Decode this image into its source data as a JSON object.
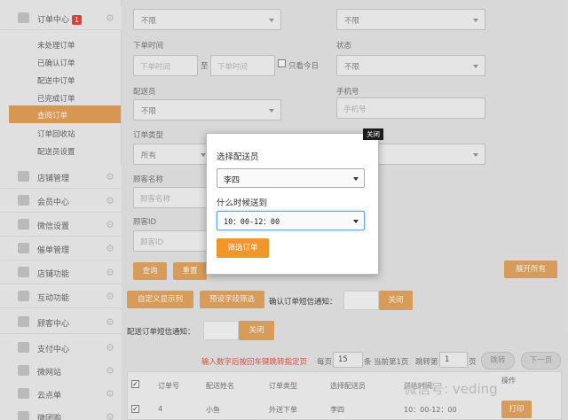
{
  "sidebar": {
    "order_center": "订单中心",
    "order_badge": "1",
    "subitems": [
      "未处理订单",
      "已确认订单",
      "配送中订单",
      "已完成订单",
      "查阅订单",
      "订单回收站",
      "配送员设置"
    ],
    "menus": [
      "店铺管理",
      "会员中心",
      "微信设置",
      "催单管理",
      "店铺功能",
      "互动功能",
      "顾客中心",
      "支付中心",
      "微网站",
      "云点单",
      "微团购"
    ]
  },
  "form": {
    "top_left_select": "不限",
    "top_right_select": "不限",
    "order_time_label": "下单时间",
    "time_from_placeholder": "下单时间",
    "to": "至",
    "time_to_placeholder": "下单时间",
    "today_only": "只看今日",
    "status_label": "状态",
    "status_value": "不限",
    "deliverer_label": "配送员",
    "deliverer_value": "不限",
    "phone_label": "手机号",
    "phone_placeholder": "手机号",
    "order_type_label": "订单类型",
    "order_type_value": "所有",
    "customer_name_label": "顾客名称",
    "customer_name_placeholder": "顾客名称",
    "customer_id_label": "顾客ID",
    "customer_id_placeholder": "顾客ID",
    "query_btn": "查询",
    "reset_btn": "重置",
    "expand_all": "展开所有",
    "custom_display": "自定义显示列",
    "preset_filter": "预设字段筛选",
    "confirm_sms_label": "确认订单短信通知：",
    "confirm_sms_toggle": "关闭",
    "delivery_sms_label": "配送订单短信通知：",
    "delivery_sms_toggle": "关闭"
  },
  "pagination": {
    "hint": "输入数字后按回车键跳转指定页",
    "per_page_label": "每页",
    "per_page": "15",
    "items": "条",
    "current_page": "当前第1页",
    "jump_label": "跳转第",
    "jump_value": "1",
    "page": "页",
    "jump_btn": "跳转",
    "next_btn": "下一页"
  },
  "table": {
    "headers": [
      "订单号",
      "配送姓名",
      "订单类型",
      "选择配送员",
      "送达时间",
      "操作"
    ],
    "row": {
      "order_no": "4",
      "name": "小鱼",
      "type": "外送下单",
      "deliverer": "李四",
      "time": "10：00-12：00",
      "action": "打印"
    }
  },
  "modal": {
    "close": "关闭",
    "choose_deliverer": "选择配送员",
    "deliverer_value": "李四",
    "delivery_time_label": "什么时候送到",
    "delivery_time_value": "10：00-12：00",
    "filter_btn": "筛选订单"
  },
  "watermark": "微信号: veding"
}
